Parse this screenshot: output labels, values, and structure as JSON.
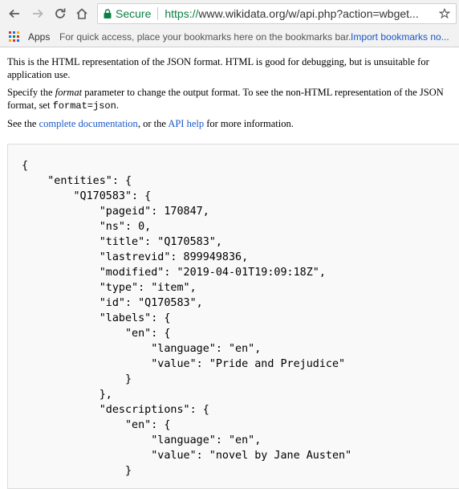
{
  "browser": {
    "secure_label": "Secure",
    "url_scheme": "https://",
    "url_rest": "www.wikidata.org/w/api.php?action=wbget..."
  },
  "bookmarks_bar": {
    "apps_label": "Apps",
    "hint": "For quick access, place your bookmarks here on the bookmarks bar.",
    "import_link": "Import bookmarks no..."
  },
  "page": {
    "intro": "This is the HTML representation of the JSON format. HTML is good for debugging, but is unsuitable for application use.",
    "specify_pre": "Specify the ",
    "specify_param": "format",
    "specify_mid": " parameter to change the output format. To see the non-HTML representation of the JSON format, set ",
    "specify_code": "format=json",
    "specify_end": ".",
    "see_pre": "See the ",
    "see_link1": "complete documentation",
    "see_mid": ", or the ",
    "see_link2": "API help",
    "see_end": " for more information."
  },
  "json_lines": [
    "{",
    "    \"entities\": {",
    "        \"Q170583\": {",
    "            \"pageid\": 170847,",
    "            \"ns\": 0,",
    "            \"title\": \"Q170583\",",
    "            \"lastrevid\": 899949836,",
    "            \"modified\": \"2019-04-01T19:09:18Z\",",
    "            \"type\": \"item\",",
    "            \"id\": \"Q170583\",",
    "            \"labels\": {",
    "                \"en\": {",
    "                    \"language\": \"en\",",
    "                    \"value\": \"Pride and Prejudice\"",
    "                }",
    "            },",
    "            \"descriptions\": {",
    "                \"en\": {",
    "                    \"language\": \"en\",",
    "                    \"value\": \"novel by Jane Austen\"",
    "                }"
  ]
}
